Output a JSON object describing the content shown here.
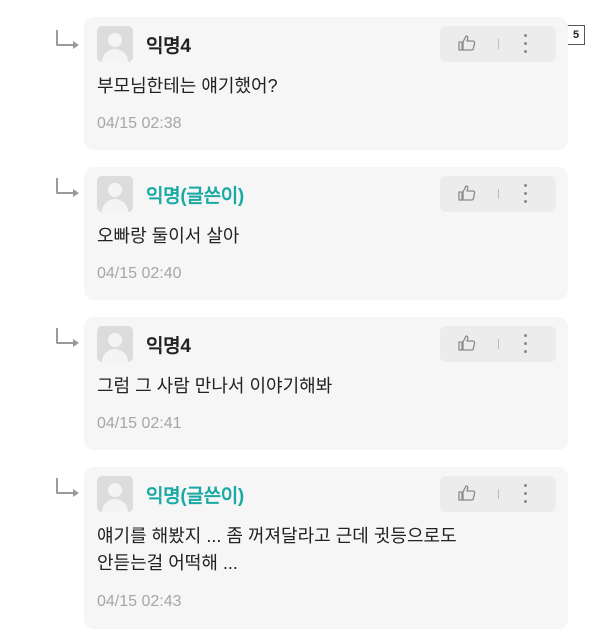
{
  "page_badge": "5",
  "comments": [
    {
      "name": "익명4",
      "content": "부모님한테는 얘기했어?",
      "time": "04/15 02:38"
    },
    {
      "name": "익명(글쓴이)",
      "content": "오빠랑 둘이서 살아",
      "time": "04/15 02:40"
    },
    {
      "name": "익명4",
      "content": "그럼 그 사람 만나서 이야기해봐",
      "time": "04/15 02:41"
    },
    {
      "name": "익명(글쓴이)",
      "content_line1": "얘기를 해봤지 ... 좀 꺼져달라고 근데 귓등으로도",
      "content_line2": "안듣는걸 어떡해 ...",
      "time": "04/15 02:43"
    }
  ],
  "colors": {
    "author_name": "#1aa9a5",
    "card_bg": "#f6f6f6",
    "time_text": "#a6a6a6"
  },
  "icons": {
    "like": "thumbs-up-icon",
    "more": "more-vertical-icon",
    "reply": "reply-arrow-icon",
    "avatar": "default-avatar-icon"
  }
}
